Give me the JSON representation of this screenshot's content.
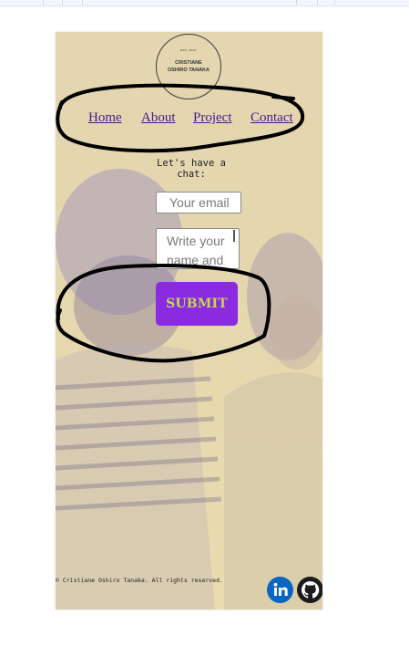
{
  "logo": {
    "top_text": "EST. 2022",
    "line1": "CRISTIANE",
    "line2": "OSHIRO TANAKA",
    "bottom_text": "FRONTEND DEVELOPER"
  },
  "nav": {
    "items": [
      {
        "label": "Home"
      },
      {
        "label": "About"
      },
      {
        "label": "Project"
      },
      {
        "label": "Contact"
      }
    ]
  },
  "contact": {
    "title": "Let's have a chat:",
    "email_placeholder": "Your email",
    "message_placeholder": "Write your name and message",
    "submit_label": "SUBMIT"
  },
  "footer": {
    "copyright": "© Cristiane Oshiro Tanaka. All rights reserved.",
    "linkedin_icon": "linkedin-icon",
    "github_icon": "github-icon"
  },
  "colors": {
    "page_bg": "#e4d7ae",
    "nav_link": "#4b1b8c",
    "submit_bg": "#8a2be2",
    "submit_text": "#c4d94a",
    "linkedin": "#0a66c2",
    "github": "#1b1b1b",
    "scribble": "#000000"
  }
}
